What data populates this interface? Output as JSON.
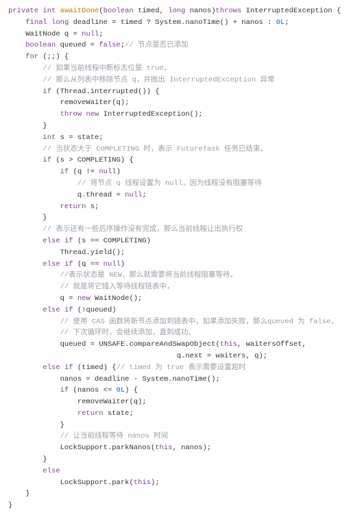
{
  "code": {
    "line1": {
      "kw_private": "private",
      "kw_int": "int",
      "name": "awaitDone",
      "lp": "(",
      "kw_boolean": "boolean",
      "p_timed": " timed, ",
      "kw_long": "long",
      "p_nanos": " nanos)",
      "kw_throws": "throws",
      "ex": " InterruptedException {"
    },
    "line2": {
      "kw_final": "final",
      "sp": " ",
      "kw_long": "long",
      "rest": " deadline = timed ? System.nanoTime() + nanos : ",
      "zero": "0L",
      "semi": ";"
    },
    "line3": {
      "txt": "WaitNode q = ",
      "kw_null": "null",
      "semi": ";"
    },
    "line4": {
      "kw_boolean": "boolean",
      "rest": " queued = ",
      "kw_false": "false",
      "semi": ";",
      "comment": "// 节点是否已添加"
    },
    "line5": {
      "kw_for": "for",
      "rest": " (;;) {"
    },
    "line6": {
      "comment": "// 如果当前线程中断标志位是 true，"
    },
    "line7": {
      "comment": "// 那么从列表中移除节点 q，并抛出 InterruptedException 异常"
    },
    "line8": {
      "kw_if": "if",
      "rest": " (Thread.interrupted()) {"
    },
    "line9": {
      "txt": "removeWaiter(q);"
    },
    "line10": {
      "kw_throw": "throw",
      "sp": " ",
      "kw_new": "new",
      "rest": " InterruptedException();"
    },
    "line11": {
      "txt": "}"
    },
    "line12": {
      "kw_int": "int",
      "rest": " s = state;"
    },
    "line13": {
      "comment": "// 当状态大于 COMPLETING 时，表示 FutureTask 任务已结束。"
    },
    "line14": {
      "kw_if": "if",
      "rest": " (s > COMPLETING) {"
    },
    "line15": {
      "kw_if": "if",
      "rest": " (q != ",
      "kw_null": "null",
      "close": ")"
    },
    "line16": {
      "comment": "// 将节点 q 线程设置为 null，因为线程没有阻塞等待"
    },
    "line17": {
      "txt": "q.thread = ",
      "kw_null": "null",
      "semi": ";"
    },
    "line18": {
      "kw_return": "return",
      "rest": " s;"
    },
    "line19": {
      "txt": "}"
    },
    "line20": {
      "comment": "// 表示还有一些后序操作没有完成，那么当前线程让出执行权"
    },
    "line21": {
      "kw_else": "else",
      "sp": " ",
      "kw_if": "if",
      "rest": " (s == COMPLETING)"
    },
    "line22": {
      "txt": "Thread.yield();"
    },
    "line23": {
      "kw_else": "else",
      "sp": " ",
      "kw_if": "if",
      "rest": " (q == ",
      "kw_null": "null",
      "close": ")"
    },
    "line24": {
      "comment": "//表示状态是 NEW，那么就需要将当前线程阻塞等待。"
    },
    "line25": {
      "comment": "// 就是将它插入等待线程链表中，"
    },
    "line26": {
      "txt": "q = ",
      "kw_new": "new",
      "rest": " WaitNode();"
    },
    "line27": {
      "kw_else": "else",
      "sp": " ",
      "kw_if": "if",
      "rest": " (!queued)"
    },
    "line28": {
      "comment": "// 使用 CAS 函数将新节点添加到链表中，如果添加失败，那么queued 为 false，"
    },
    "line29": {
      "comment": "// 下次循环时，会继续添加，直到成功。"
    },
    "line30": {
      "txt": "queued = UNSAFE.compareAndSwapObject(",
      "kw_this": "this",
      "rest": ", waitersOffset,"
    },
    "line31": {
      "txt": "q.next = waiters, q);"
    },
    "line32": {
      "kw_else": "else",
      "sp": " ",
      "kw_if": "if",
      "rest": " (timed) {",
      "comment": "// timed 为 true 表示需要设置超时"
    },
    "line33": {
      "txt": "nanos = deadline - System.nanoTime();"
    },
    "line34": {
      "kw_if": "if",
      "rest": " (nanos <= ",
      "zero": "0L",
      "close": ") {"
    },
    "line35": {
      "txt": "removeWaiter(q);"
    },
    "line36": {
      "kw_return": "return",
      "rest": " state;"
    },
    "line37": {
      "txt": "}"
    },
    "line38": {
      "comment": "// 让当前线程等待 nanos 时间"
    },
    "line39": {
      "txt": "LockSupport.parkNanos(",
      "kw_this": "this",
      "rest": ", nanos);"
    },
    "line40": {
      "txt": "}"
    },
    "line41": {
      "kw_else": "else"
    },
    "line42": {
      "txt": "LockSupport.park(",
      "kw_this": "this",
      "rest": ");"
    },
    "line43": {
      "txt": "}"
    },
    "line44": {
      "txt": "}"
    }
  }
}
